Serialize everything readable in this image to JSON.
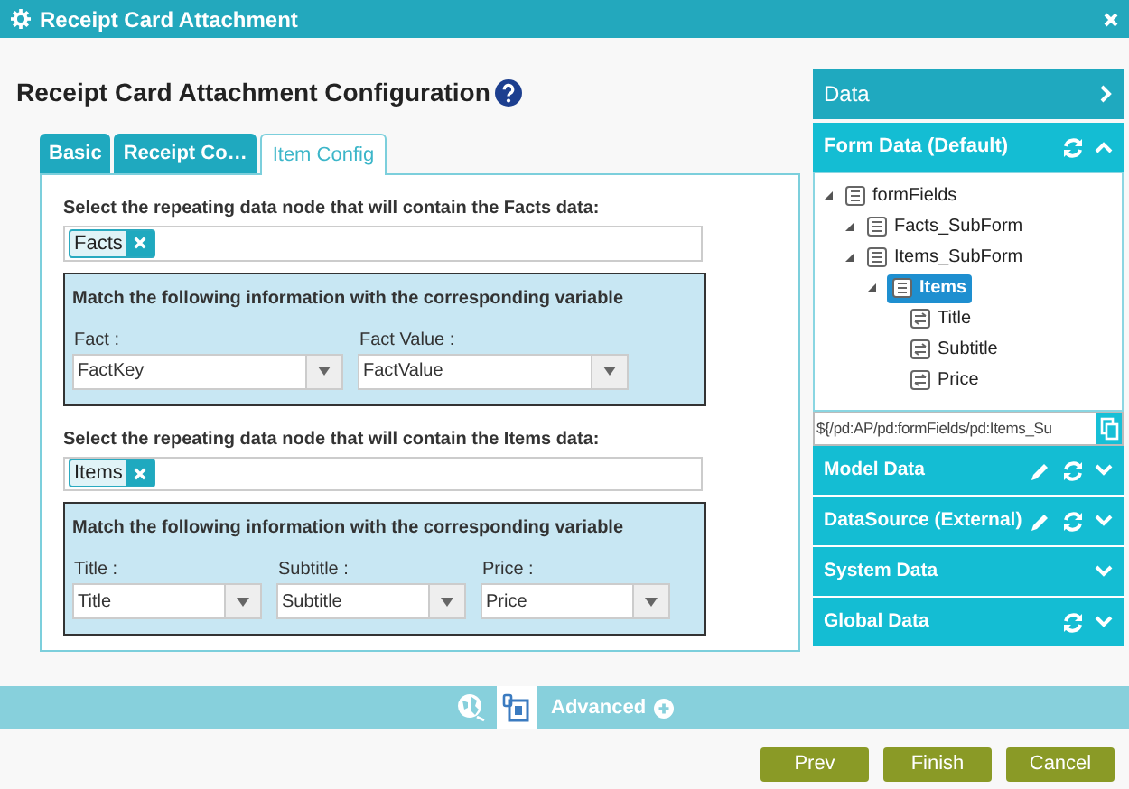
{
  "window": {
    "title": "Receipt Card Attachment"
  },
  "heading": "Receipt Card Attachment Configuration",
  "tabs": [
    {
      "label": "Basic",
      "selected": false
    },
    {
      "label": "Receipt Co…",
      "selected": false
    },
    {
      "label": "Item Config",
      "selected": true
    }
  ],
  "sections": [
    {
      "kind": "node",
      "label": "Select the repeating data node that will contain the Facts data:",
      "tag": "Facts"
    },
    {
      "kind": "match",
      "title": "Match the following information with the corresponding variable",
      "fields": [
        {
          "label": "Fact :",
          "value": "FactKey"
        },
        {
          "label": "Fact Value :",
          "value": "FactValue"
        }
      ]
    },
    {
      "kind": "node",
      "label": "Select the repeating data node that will contain the Items data:",
      "tag": "Items"
    },
    {
      "kind": "match",
      "title": "Match the following information with the corresponding variable",
      "fields": [
        {
          "label": "Title :",
          "value": "Title"
        },
        {
          "label": "Subtitle :",
          "value": "Subtitle"
        },
        {
          "label": "Price :",
          "value": "Price"
        }
      ]
    }
  ],
  "data_panel": {
    "title": "Data",
    "form_data": {
      "title": "Form Data (Default)",
      "expanded": true,
      "tree": [
        {
          "label": "formFields",
          "kind": "group",
          "selected": false,
          "children": [
            {
              "label": "Facts_SubForm",
              "kind": "group",
              "selected": false
            },
            {
              "label": "Items_SubForm",
              "kind": "group",
              "selected": false,
              "children": [
                {
                  "label": "Items",
                  "kind": "group",
                  "selected": true,
                  "children": [
                    {
                      "label": "Title",
                      "kind": "field",
                      "selected": false
                    },
                    {
                      "label": "Subtitle",
                      "kind": "field",
                      "selected": false
                    },
                    {
                      "label": "Price",
                      "kind": "field",
                      "selected": false
                    }
                  ]
                }
              ]
            }
          ]
        }
      ],
      "path": "${/pd:AP/pd:formFields/pd:Items_Su"
    },
    "sections": [
      {
        "title": "Model Data",
        "edit": true,
        "refresh": true,
        "expanded": false
      },
      {
        "title": "DataSource (External)",
        "edit": true,
        "refresh": true,
        "expanded": false
      },
      {
        "title": "System Data",
        "edit": false,
        "refresh": false,
        "expanded": false
      },
      {
        "title": "Global Data",
        "edit": false,
        "refresh": true,
        "expanded": false
      }
    ]
  },
  "footer": {
    "advanced": "Advanced"
  },
  "buttons": [
    "Prev",
    "Finish",
    "Cancel"
  ]
}
